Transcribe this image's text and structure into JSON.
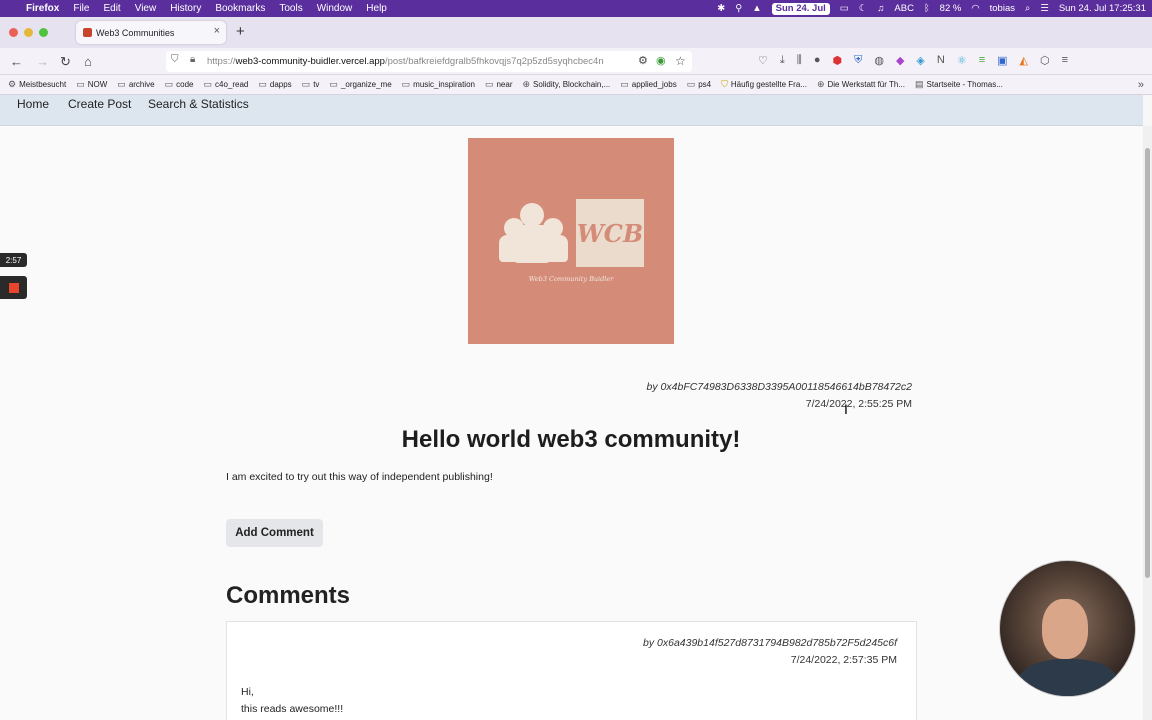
{
  "menubar": {
    "app": "Firefox",
    "items": [
      "File",
      "Edit",
      "View",
      "History",
      "Bookmarks",
      "Tools",
      "Window",
      "Help"
    ],
    "date_badge": "Sun 24. Jul",
    "kbd": "ABC",
    "battery": "82 %",
    "user": "tobias",
    "clock": "Sun 24. Jul  17:25:31"
  },
  "browser": {
    "tab_title": "Web3 Communities",
    "url_host": "web3-community-buidler.vercel.app",
    "url_prefix": "https://",
    "url_path": "/post/bafkreiefdgralb5fhkovqjs7q2p5zd5syqhcbec4n"
  },
  "bookmarks": [
    "Meistbesucht",
    "NOW",
    "archive",
    "code",
    "c4o_read",
    "dapps",
    "tv",
    "_organize_me",
    "music_inspiration",
    "near",
    "Solidity, Blockchain,...",
    "applied_jobs",
    "ps4",
    "Häufig gestellte Fra...",
    "Die Werkstatt für Th...",
    "Startseite - Thomas..."
  ],
  "app_nav": {
    "home": "Home",
    "create": "Create Post",
    "search": "Search & Statistics"
  },
  "logo": {
    "text": "WCB",
    "subtitle": "Web3 Community Buidler",
    "bg_color": "#d48c78"
  },
  "post": {
    "author": "by 0x4bFC74983D6338D3395A00118546614bB78472c2",
    "timestamp": "7/24/2022, 2:55:25 PM",
    "title": "Hello world web3 community!",
    "body": "I am excited to try out this way of independent publishing!",
    "add_comment_label": "Add Comment"
  },
  "comments": {
    "heading": "Comments",
    "items": [
      {
        "author": "by 0x6a439b14f527d8731794B982d785b72F5d245c6f",
        "timestamp": "7/24/2022, 2:57:35 PM",
        "line1": "Hi,",
        "line2": "this reads awesome!!!"
      }
    ]
  },
  "overlay": {
    "timer": "2:57"
  }
}
